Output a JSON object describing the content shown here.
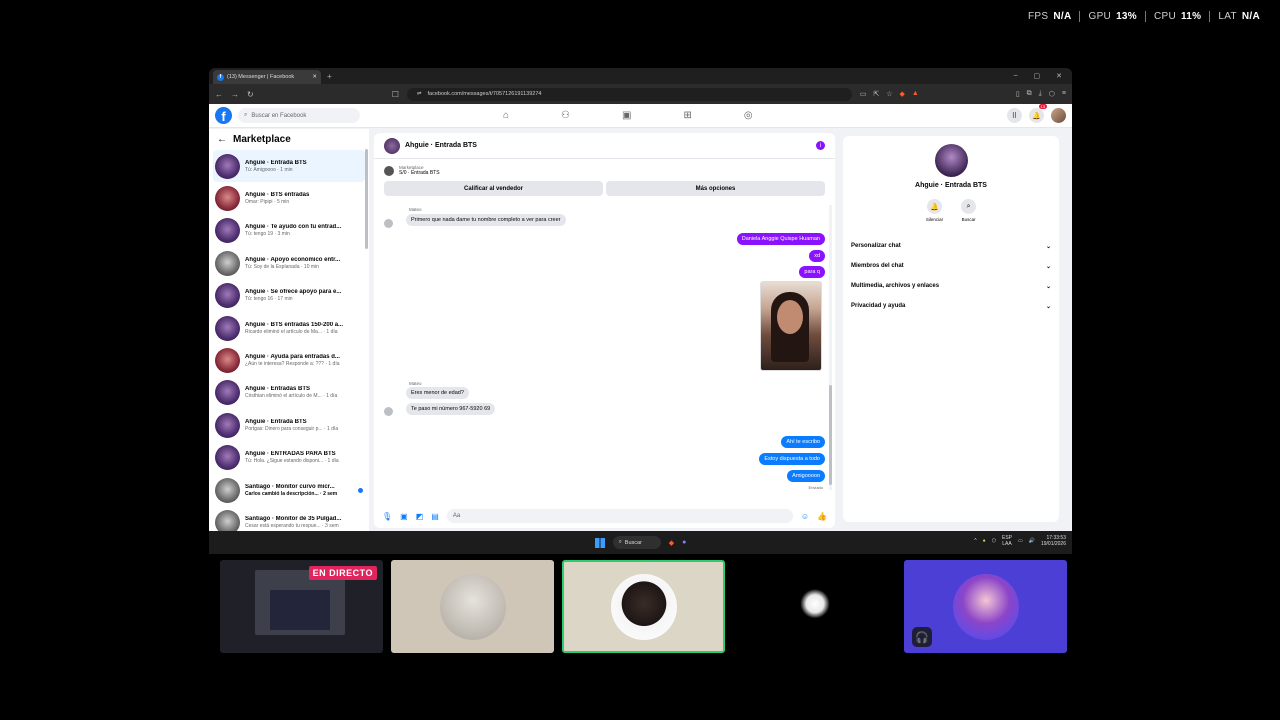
{
  "perf": [
    {
      "label": "FPS",
      "value": "N/A"
    },
    {
      "label": "GPU",
      "value": "13%"
    },
    {
      "label": "CPU",
      "value": "11%"
    },
    {
      "label": "LAT",
      "value": "N/A"
    }
  ],
  "browser": {
    "tab_title": "(13) Messenger | Facebook",
    "url": "facebook.com/messages/t/7057126191139274"
  },
  "fb": {
    "search_placeholder": "Buscar en Facebook",
    "notif_count": "13"
  },
  "sidebar": {
    "title": "Marketplace",
    "conversations": [
      {
        "name": "Ahguie · Entrada BTS",
        "snippet": "Tú: Amigoooo · 1 min"
      },
      {
        "name": "Ahguie · BTS entradas",
        "snippet": "Omar: Pipipi · 5 min"
      },
      {
        "name": "Ahguie · Te ayudo con tu entrad...",
        "snippet": "Tú: tengo 19 · 3 min"
      },
      {
        "name": "Ahguie · Apoyo económico entr...",
        "snippet": "Tú: Soy de la Esplanada · 10 min"
      },
      {
        "name": "Ahguie · Se ofrece apoyo para e...",
        "snippet": "Tú: tengo 16 · 17 min"
      },
      {
        "name": "Ahguie · BTS entradas 150-200 a...",
        "snippet": "Ricardo eliminó el artículo de Ma... · 1 día"
      },
      {
        "name": "Ahguie · Ayuda para entradas d...",
        "snippet": "¿Aún te interesa? Responde a: ??? · 1 día"
      },
      {
        "name": "Ahguie · Entradas BTS",
        "snippet": "Cristhian eliminó el artículo de M... · 1 día"
      },
      {
        "name": "Ahguie · Entrada BTS",
        "snippet": "Portgas: Dinero para conseguir p... · 1 día"
      },
      {
        "name": "Ahguie · ENTRADAS PARA BTS",
        "snippet": "Tú: Hola. ¿Sigue estando disponi... · 1 día"
      },
      {
        "name": "Santiago · Monitor curvo micr...",
        "snippet": "Carlos cambió la descripción... · 2 sem"
      },
      {
        "name": "Santiago · Monitor de 35 Pulgad...",
        "snippet": "Cesar está esperando tu respue... · 3 sem"
      }
    ]
  },
  "chat": {
    "title": "Ahguie · Entrada BTS",
    "marketplace_label": "Marketplace",
    "listing": "S/0 · Entrada BTS",
    "rate_seller": "Calificar al vendedor",
    "more_options": "Más opciones",
    "sender_name": "Mateo",
    "incoming1": "Primero que nada dame tu nombre completo a ver para creer",
    "out1": "Daniela Anggie Quispe Huaman",
    "out2": "xd",
    "out3": "para q",
    "incoming2": "Eres menor de edad?",
    "incoming3": "Te paso mi número 967-5920 69",
    "out4": "Ahí te escribo",
    "out5": "Estoy dispuesta a todo",
    "out6": "Amigooooo",
    "sent_status": "Enviado",
    "composer_placeholder": "Aa"
  },
  "details": {
    "name": "Ahguie · Entrada BTS",
    "mute": "Silenciar",
    "search": "Buscar",
    "options": [
      "Personalizar chat",
      "Miembros del chat",
      "Multimedia, archivos y enlaces",
      "Privacidad y ayuda"
    ]
  },
  "taskbar": {
    "search": "Buscar",
    "lang1": "ESP",
    "lang2": "LAA",
    "time": "17:33:53",
    "date": "19/01/2026"
  },
  "stream": {
    "live": "EN DIRECTO"
  }
}
